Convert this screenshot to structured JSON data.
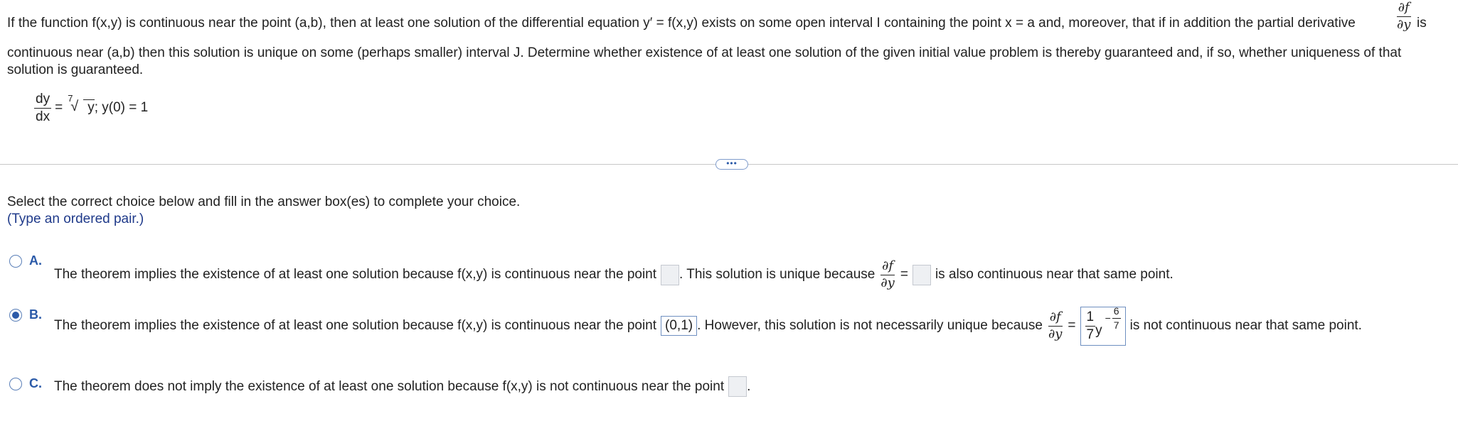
{
  "problem": {
    "line1_a": "If the function f(x,y) is continuous near the point (a,b), then at least one solution of the differential equation y′ = f(x,y) exists on some open interval I containing the point x = a and, moreover, that if in addition the partial derivative",
    "partial_num": "∂f",
    "partial_den": "∂y",
    "line1_b": "is",
    "line2": "continuous near (a,b) then this solution is unique on some (perhaps smaller) interval J. Determine whether existence of at least one solution of the given initial value problem is thereby guaranteed and, if so, whether uniqueness of that",
    "line3": "solution is guaranteed.",
    "eq_num": "dy",
    "eq_den": "dx",
    "eq_equals": "=",
    "eq_root_index": "7",
    "eq_radicand": "y",
    "eq_tail": "; y(0) = 1"
  },
  "more_button": "•••",
  "instructions": {
    "line1": "Select the correct choice below and fill in the answer box(es) to complete your choice.",
    "line2": "(Type an ordered pair.)"
  },
  "choices": [
    {
      "letter": "A.",
      "selected": false,
      "text1": "The theorem implies the existence of at least one solution because f(x,y) is continuous near the point",
      "text2": ". This solution is unique because",
      "text3": "=",
      "text4": "is also continuous near that same point."
    },
    {
      "letter": "B.",
      "selected": true,
      "text1": "The theorem implies the existence of at least one solution because f(x,y) is continuous near the point",
      "point_value": "(0,1)",
      "text2": ". However, this solution is not necessarily unique because",
      "text3": "=",
      "deriv_num": "1",
      "deriv_den": "7",
      "deriv_var": "y",
      "deriv_exp_sign": "−",
      "deriv_exp_num": "6",
      "deriv_exp_den": "7",
      "text4": "is not continuous near that same point."
    },
    {
      "letter": "C.",
      "selected": false,
      "text1": "The theorem does not imply the existence of at least one solution because f(x,y) is not continuous near the point",
      "text2": "."
    }
  ]
}
